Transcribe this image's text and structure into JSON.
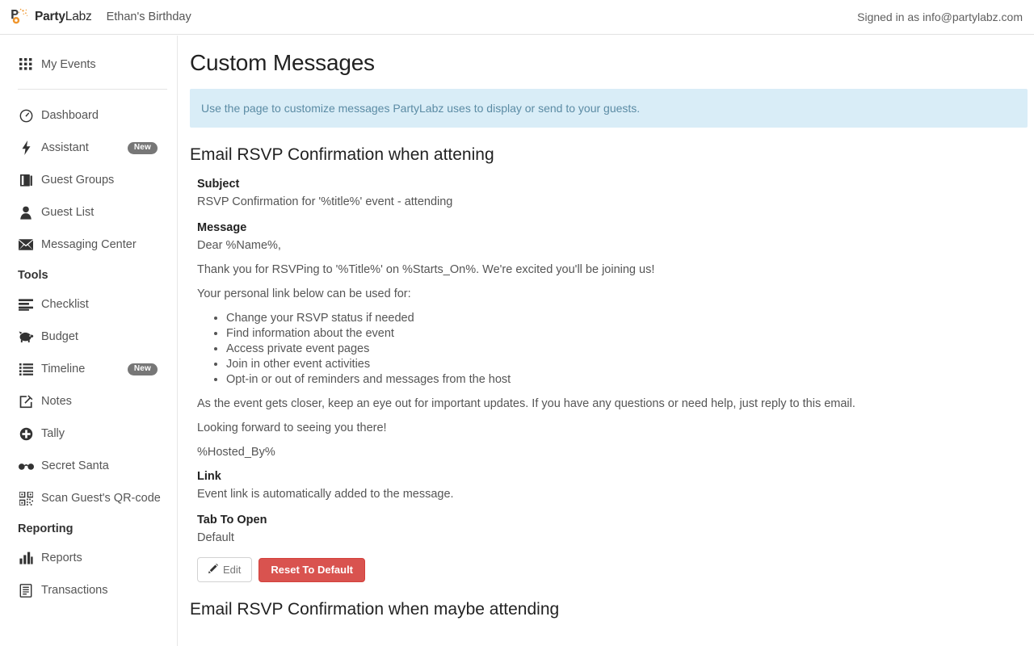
{
  "header": {
    "brand_prefix": "Party",
    "brand_suffix": "Labz",
    "logo_icon": "party-popper-logo",
    "event_title": "Ethan's Birthday",
    "signed_in_text": "Signed in as info@partylabz.com"
  },
  "sidebar": {
    "primary": [
      {
        "label": "My Events",
        "icon": "grid-icon"
      }
    ],
    "items": [
      {
        "label": "Dashboard",
        "icon": "speedometer-icon",
        "badge": null
      },
      {
        "label": "Assistant",
        "icon": "lightning-bolt-icon",
        "badge": "New"
      },
      {
        "label": "Guest Groups",
        "icon": "books-icon",
        "badge": null
      },
      {
        "label": "Guest List",
        "icon": "person-icon",
        "badge": null
      },
      {
        "label": "Messaging Center",
        "icon": "envelope-icon",
        "badge": null
      }
    ],
    "tools_heading": "Tools",
    "tools": [
      {
        "label": "Checklist",
        "icon": "checklist-icon",
        "badge": null
      },
      {
        "label": "Budget",
        "icon": "piggy-bank-icon",
        "badge": null
      },
      {
        "label": "Timeline",
        "icon": "list-icon",
        "badge": "New"
      },
      {
        "label": "Notes",
        "icon": "note-edit-icon",
        "badge": null
      },
      {
        "label": "Tally",
        "icon": "plus-circle-icon",
        "badge": null
      },
      {
        "label": "Secret Santa",
        "icon": "glasses-icon",
        "badge": null
      },
      {
        "label": "Scan Guest's QR-code",
        "icon": "qr-code-icon",
        "badge": null
      }
    ],
    "reporting_heading": "Reporting",
    "reporting": [
      {
        "label": "Reports",
        "icon": "bar-chart-icon",
        "badge": null
      },
      {
        "label": "Transactions",
        "icon": "document-list-icon",
        "badge": null
      }
    ]
  },
  "main": {
    "page_title": "Custom Messages",
    "info_banner": "Use the page to customize messages PartyLabz uses to display or send to your guests.",
    "section_1": {
      "title": "Email RSVP Confirmation when attening",
      "subject_label": "Subject",
      "subject_value": "RSVP Confirmation for '%title%' event - attending",
      "message_label": "Message",
      "message_paragraphs": [
        "Dear %Name%,",
        "Thank you for RSVPing to '%Title%' on %Starts_On%. We're excited you'll be joining us!",
        "Your personal link below can be used for:"
      ],
      "message_bullets": [
        "Change your RSVP status if needed",
        "Find information about the event",
        "Access private event pages",
        "Join in other event activities",
        "Opt-in or out of reminders and messages from the host"
      ],
      "message_closing": [
        "As the event gets closer, keep an eye out for important updates. If you have any questions or need help, just reply to this email.",
        "Looking forward to seeing you there!",
        "%Hosted_By%"
      ],
      "link_label": "Link",
      "link_value": "Event link is automatically added to the message.",
      "tab_label": "Tab To Open",
      "tab_value": "Default",
      "edit_button": "Edit",
      "reset_button": "Reset To Default"
    },
    "section_2": {
      "title": "Email RSVP Confirmation when maybe attending"
    }
  },
  "colors": {
    "danger": "#d9534f",
    "info_bg": "#d9edf7",
    "info_text": "#5b8ba4",
    "brand_orange": "#f0962d",
    "badge_grey": "#777777"
  }
}
